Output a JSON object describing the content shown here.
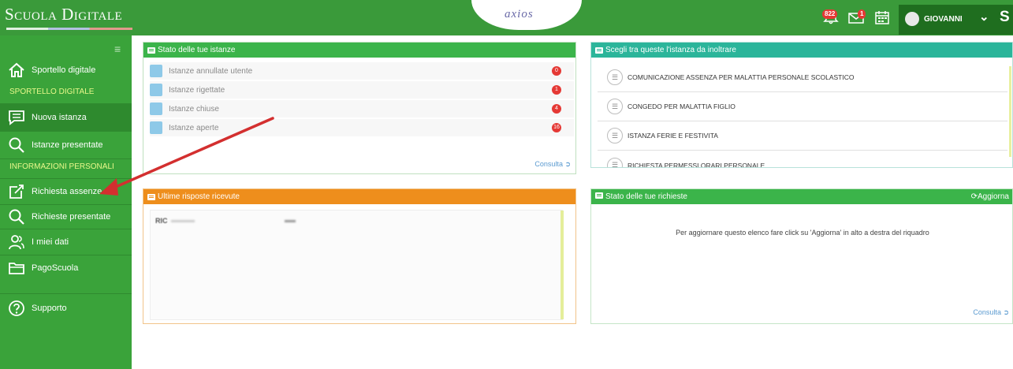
{
  "header": {
    "brand": "Scuola Digitale",
    "logo": "axios",
    "notifications_badge": "822",
    "messages_badge": "1",
    "user_name": "GIOVANNI",
    "user_trailing": "S",
    "icons": [
      "bell-icon",
      "mail-icon",
      "calendar-icon",
      "avatar",
      "chevron-down-icon"
    ]
  },
  "sidebar": {
    "toggle_icon": "hamburger-icon",
    "items": [
      {
        "label": "Sportello digitale",
        "icon": "home-icon"
      },
      {
        "label": "Nuova istanza",
        "icon": "chat-icon"
      },
      {
        "label": "Istanze presentate",
        "icon": "search-icon"
      },
      {
        "label": "Richiesta assenze",
        "icon": "edit-icon"
      },
      {
        "label": "Richieste presentate",
        "icon": "search-icon"
      },
      {
        "label": "I miei dati",
        "icon": "users-icon"
      },
      {
        "label": "PagoScuola",
        "icon": "folder-icon"
      },
      {
        "label": "Supporto",
        "icon": "help-icon"
      }
    ],
    "sections": [
      "SPORTELLO DIGITALE",
      "INFORMAZIONI PERSONALI"
    ]
  },
  "panels": {
    "stato_istanze": {
      "title": "Stato delle tue istanze",
      "rows": [
        {
          "label": "Istanze annullate utente",
          "count": "0"
        },
        {
          "label": "Istanze rigettate",
          "count": "1"
        },
        {
          "label": "Istanze chiuse",
          "count": "4"
        },
        {
          "label": "Istanze aperte",
          "count": "16"
        }
      ],
      "link": "Consulta"
    },
    "scegli_istanza": {
      "title": "Scegli tra queste l'istanza da inoltrare",
      "rows": [
        "COMUNICAZIONE ASSENZA PER MALATTIA PERSONALE SCOLASTICO",
        "CONGEDO PER MALATTIA FIGLIO",
        "ISTANZA FERIE E FESTIVITA",
        "RICHIESTA PERMESSI ORARI PERSONALE"
      ]
    },
    "ultime_risposte": {
      "title": "Ultime risposte ricevute",
      "content_blurred": "RIC"
    },
    "stato_richieste": {
      "title": "Stato delle tue richieste",
      "action": "Aggiorna",
      "message": "Per aggiornare questo elenco fare click su 'Aggiorna' in alto a destra del riquadro",
      "link": "Consulta"
    }
  },
  "colors": {
    "header_green": "#3a9a3a",
    "sidebar_green": "#3aa33a",
    "active_item": "#2e8a2e",
    "section_text": "#e8f88a",
    "panel_green": "#3bb44a",
    "panel_orange": "#ee8e1c",
    "panel_teal": "#2bb59a",
    "badge_red": "#e53935",
    "annotation_arrow": "#d32f2f"
  }
}
